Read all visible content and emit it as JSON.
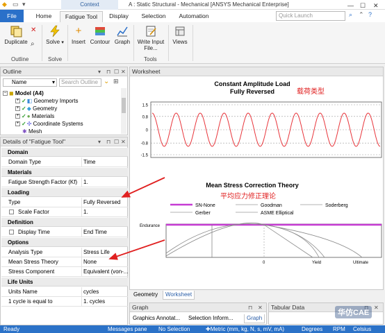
{
  "titlebar": {
    "contextual": "Context",
    "title": "A : Static Structural - Mechanical [ANSYS Mechanical Enterprise]",
    "min": "—",
    "max": "☐",
    "close": "✕"
  },
  "tabs": [
    "File",
    "Home",
    "Fatigue Tool",
    "Display",
    "Selection",
    "Automation"
  ],
  "quick_launch_placeholder": "Quick Launch",
  "ribbon": {
    "duplicate": "Duplicate",
    "outline_group": "Outline",
    "solve": "Solve",
    "solve_group": "Solve",
    "insert": "Insert",
    "contour": "Contour",
    "graph": "Graph",
    "write_input": "Write Input",
    "write_input2": "File...",
    "tools_group": "Tools",
    "views": "Views"
  },
  "outline": {
    "title": "Outline",
    "name_filter": "Name",
    "search_placeholder": "Search Outline",
    "items": [
      {
        "label": "Model (A4)",
        "bold": true
      },
      {
        "label": "Geometry Imports"
      },
      {
        "label": "Geometry"
      },
      {
        "label": "Materials"
      },
      {
        "label": "Coordinate Systems"
      },
      {
        "label": "Mesh"
      }
    ]
  },
  "details": {
    "title": "Details of \"Fatigue Tool\"",
    "sections": {
      "domain": "Domain",
      "materials": "Materials",
      "loading": "Loading",
      "definition": "Definition",
      "options": "Options",
      "life_units": "Life Units"
    },
    "rows": {
      "domain_type": [
        "Domain Type",
        "Time"
      ],
      "kf": [
        "Fatigue Strength Factor (Kf)",
        "1."
      ],
      "type": [
        "Type",
        "Fully Reversed"
      ],
      "scale": [
        "Scale Factor",
        "1."
      ],
      "display_time": [
        "Display Time",
        "End Time"
      ],
      "analysis_type": [
        "Analysis Type",
        "Stress Life"
      ],
      "mean_stress": [
        "Mean Stress Theory",
        "None"
      ],
      "stress_component": [
        "Stress Component",
        "Equivalent (von-..."
      ],
      "units_name": [
        "Units Name",
        "cycles"
      ],
      "cycle_equal": [
        "1 cycle is equal to",
        "1. cycles"
      ]
    }
  },
  "worksheet": {
    "title": "Worksheet",
    "load_title1": "Constant Amplitude Load",
    "load_title2": "Fully Reversed",
    "load_annotation": "载荷类型",
    "y_ticks": [
      "1.5",
      "0.8",
      "0",
      "-0.8",
      "-1.5"
    ],
    "msc_title": "Mean Stress Correction Theory",
    "msc_annotation": "平均应力修正理论",
    "legend": [
      "SN-None",
      "Goodman",
      "Soderberg",
      "Gerber",
      "ASME Elliptical"
    ],
    "msc_labels": {
      "endurance": "Endurance",
      "zero": "0",
      "yield": "Yield",
      "ultimate": "Ultimate"
    },
    "colors": {
      "sine": "#e8343a",
      "sn_none": "#c63bd3",
      "annotation": "#e02020",
      "arrow": "#e02020"
    }
  },
  "bottom_tabs": [
    "Geometry",
    "Worksheet"
  ],
  "graph_panel": {
    "title": "Graph",
    "tabs": [
      "Graphics Annotat...",
      "Selection Inform...",
      "Graph"
    ]
  },
  "tabular_panel": {
    "title": "Tabular Data"
  },
  "statusbar": {
    "ready": "Ready",
    "messages": "Messages pane",
    "selection": "No Selection",
    "metric": "Metric (mm, kg, N, s, mV, mA)",
    "degrees": "Degrees",
    "rpm": "RPM",
    "celsius": "Celsius"
  },
  "watermark": "华仿CAE",
  "chart_data": [
    {
      "type": "line",
      "title": "Constant Amplitude Load",
      "subtitle": "Fully Reversed",
      "ylim": [
        -1.5,
        1.5
      ],
      "yticks": [
        1.5,
        0.8,
        0,
        -0.8,
        -1.5
      ],
      "series": [
        {
          "amplitude": 1.0,
          "cycles": 9.5
        }
      ]
    },
    {
      "type": "line",
      "title": "Mean Stress Correction Theory",
      "xticks": [
        "0",
        "Yield",
        "Ultimate"
      ],
      "yticks": [
        "Endurance"
      ],
      "series": [
        {
          "name": "SN-None"
        },
        {
          "name": "Goodman"
        },
        {
          "name": "Soderberg"
        },
        {
          "name": "Gerber"
        },
        {
          "name": "ASME Elliptical"
        }
      ]
    }
  ]
}
